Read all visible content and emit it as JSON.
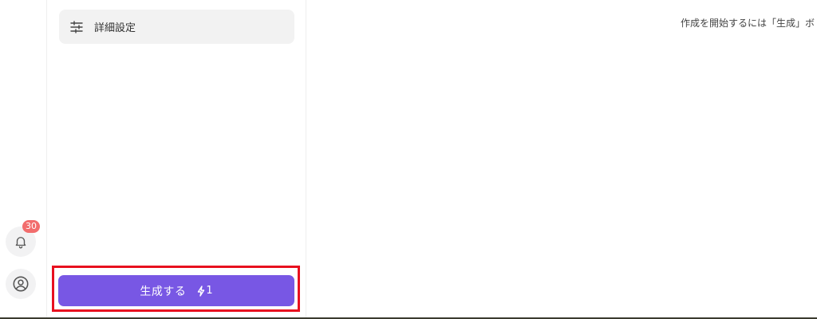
{
  "sidebar": {
    "notifications": {
      "count": "30",
      "icon": "bell-icon"
    },
    "profile": {
      "icon": "user-circle-icon"
    }
  },
  "panel": {
    "advanced_settings": {
      "label": "詳細設定",
      "icon": "sliders-icon"
    },
    "generate_button": {
      "label": "生成する",
      "credits": "1",
      "icon": "lightning-icon"
    }
  },
  "main": {
    "hint": "作成を開始するには「生成」ボ"
  },
  "colors": {
    "accent": "#7857e4",
    "badge": "#f26d6d",
    "highlight": "#e8101f"
  }
}
